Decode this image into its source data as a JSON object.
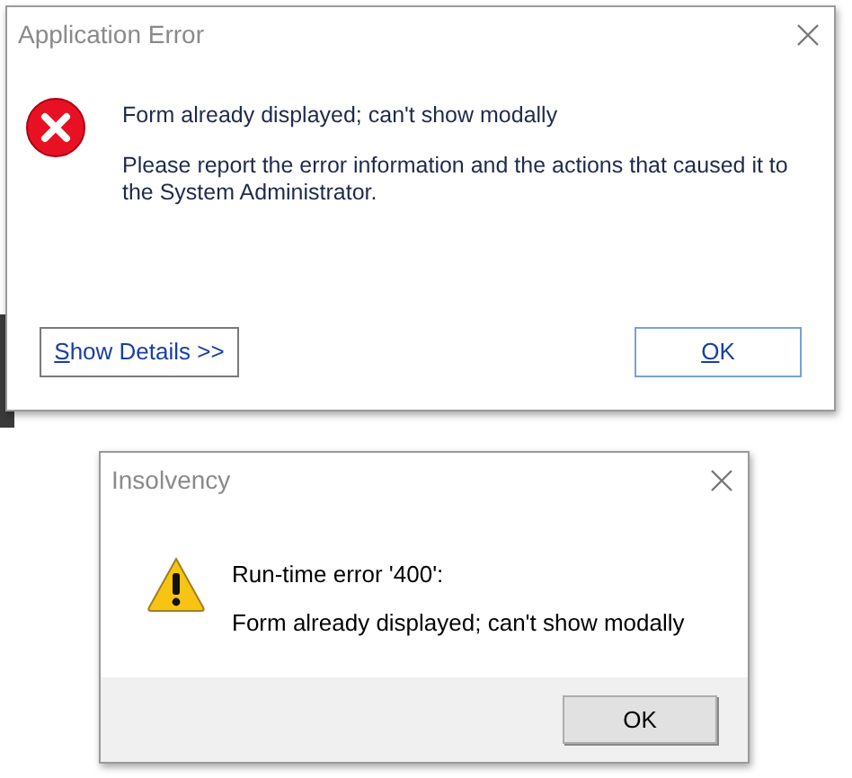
{
  "dialogs": [
    {
      "kind": "error",
      "title": "Application Error",
      "messages": [
        "Form already displayed; can't show modally",
        "Please report the error information and the actions that caused it to the System Administrator."
      ],
      "buttons": [
        {
          "kind": "details",
          "label": "Show Details >>",
          "underline_first": true
        },
        {
          "kind": "ok",
          "label": "OK",
          "underline_first": true
        }
      ]
    },
    {
      "kind": "warning",
      "title": "Insolvency",
      "messages": [
        "Run-time error '400':",
        "Form already displayed; can't show modally"
      ],
      "buttons": [
        {
          "kind": "ok",
          "label": "OK",
          "underline_first": false
        }
      ]
    }
  ]
}
